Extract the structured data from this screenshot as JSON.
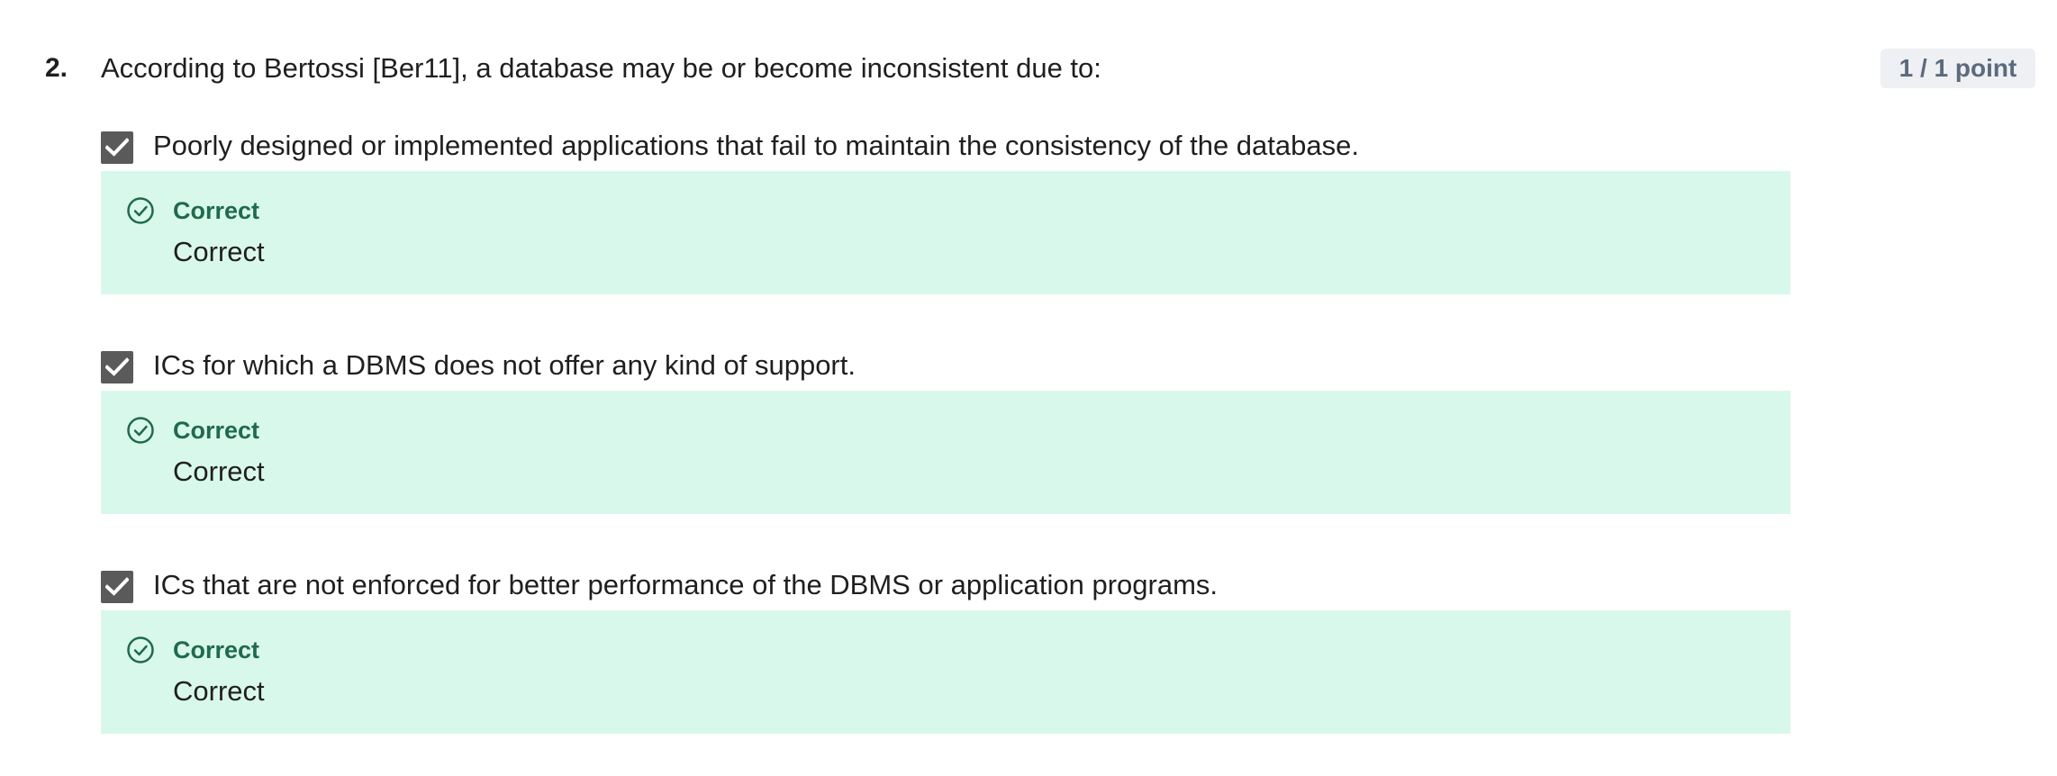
{
  "question": {
    "number": "2.",
    "prompt": "According to Bertossi [Ber11], a database may be or become inconsistent due to:",
    "points": "1 / 1 point"
  },
  "options": [
    {
      "label": "Poorly designed or implemented applications that fail to maintain the consistency of the database.",
      "checked": true,
      "feedback_title": "Correct",
      "feedback_text": "Correct"
    },
    {
      "label": "ICs for which a DBMS does not offer any kind of support.",
      "checked": true,
      "feedback_title": "Correct",
      "feedback_text": "Correct"
    },
    {
      "label": "ICs that are not enforced for better performance of the DBMS or application programs.",
      "checked": true,
      "feedback_title": "Correct",
      "feedback_text": "Correct"
    }
  ],
  "icons": {
    "checkbox": "checkmark-icon",
    "feedback": "check-circle-icon"
  },
  "colors": {
    "feedback_background": "#d9f8ec",
    "feedback_accent": "#1f6b4b",
    "checkbox_fill": "#5a5a5a",
    "points_badge_background": "#eef0f3",
    "points_badge_text": "#5b6b7d"
  }
}
